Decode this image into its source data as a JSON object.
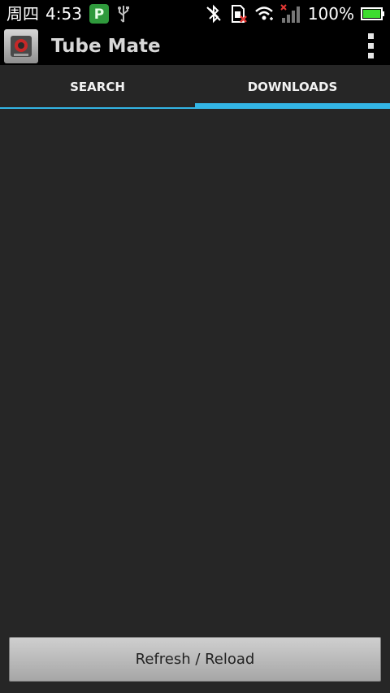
{
  "status_bar": {
    "day": "周四",
    "time": "4:53",
    "battery_text": "100%",
    "icons": [
      "parking-app-icon",
      "usb-icon",
      "bluetooth-off-icon",
      "sim-missing-icon",
      "wifi-icon",
      "signal-icon",
      "battery-icon"
    ],
    "battery_color": "#3ddc2f"
  },
  "app_bar": {
    "title": "Tube Mate",
    "icon": "tubemate-app-icon",
    "menu_icon": "overflow-menu-icon"
  },
  "tabs": [
    {
      "label": "SEARCH",
      "selected": false
    },
    {
      "label": "DOWNLOADS",
      "selected": true
    }
  ],
  "accent_color": "#33b5e5",
  "footer": {
    "refresh_label": "Refresh / Reload"
  }
}
